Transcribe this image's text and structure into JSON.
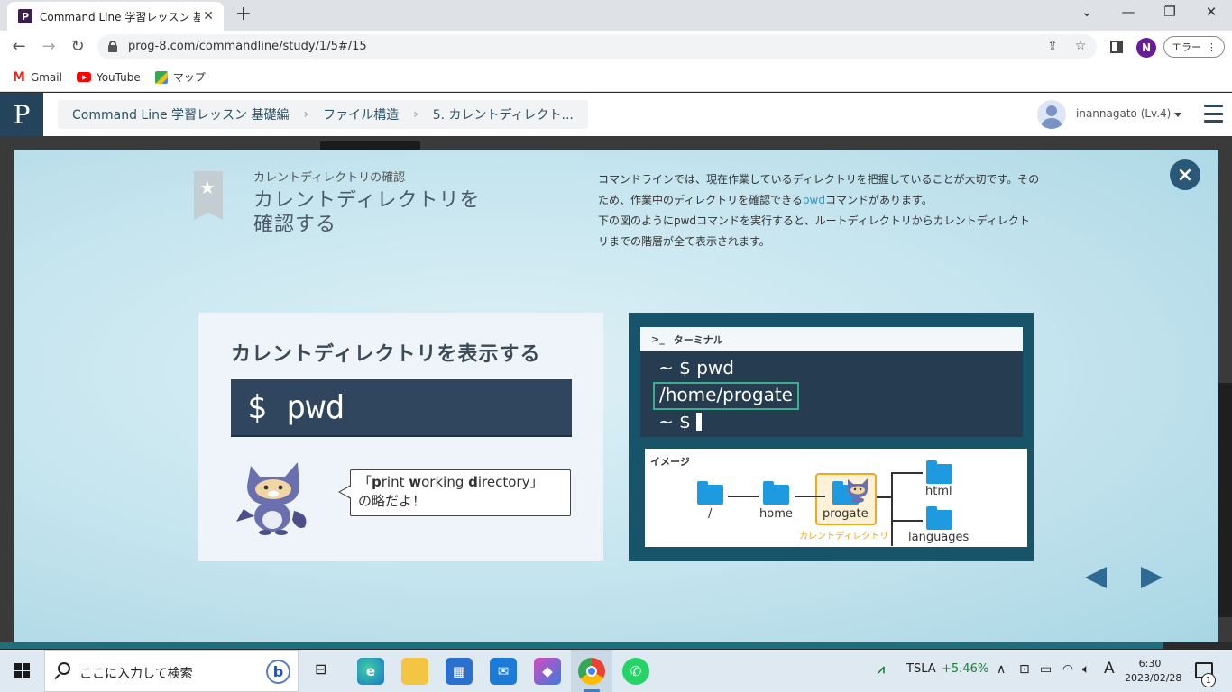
{
  "browser": {
    "tab_title": "Command Line 学習レッスン 基礎編",
    "tab_close": "✕",
    "new_tab": "+",
    "url": "prog-8.com/commandline/study/1/5#/15",
    "profile_initial": "N",
    "error_button": "エラー",
    "error_menu": "⋮",
    "bookmarks": [
      {
        "label": "Gmail",
        "icon": "gmail-icon"
      },
      {
        "label": "YouTube",
        "icon": "youtube-icon"
      },
      {
        "label": "マップ",
        "icon": "maps-icon"
      }
    ]
  },
  "progate": {
    "logo": "P",
    "breadcrumb": [
      "Command Line 学習レッスン 基礎編",
      "ファイル構造",
      "5. カレントディレクト..."
    ],
    "user": "inannagato (Lv.4)"
  },
  "slide": {
    "subtitle": "カレントディレクトリの確認",
    "title_line1": "カレントディレクトリを",
    "title_line2": "確認する",
    "desc_part1": "コマンドラインでは、現在作業しているディレクトリを把握していることが大切です。そのため、作業中のディレクトリを確認できる",
    "desc_highlight": "pwd",
    "desc_part2": "コマンドがあります。",
    "desc_line2": "下の図のようにpwdコマンドを実行すると、ルートディレクトリからカレントディレクトリまでの階層が全て表示されます。",
    "left_card": {
      "heading": "カレントディレクトリを表示する",
      "command": "$ pwd",
      "bubble_open": "「",
      "bubble_p": "p",
      "bubble_rint": "rint ",
      "bubble_w": "w",
      "bubble_orking": "orking ",
      "bubble_d": "d",
      "bubble_irectory": "irectory」",
      "bubble_line2": "の略だよ！"
    },
    "right_card": {
      "terminal_prompt_icon": ">_",
      "terminal_title": "ターミナル",
      "line1": "~ $ pwd",
      "line2": "/home/progate",
      "line3": "~ $",
      "image_label": "イメージ",
      "nodes": [
        "/",
        "home",
        "progate",
        "html",
        "languages"
      ],
      "current_label": "カレントディレクトリ"
    }
  },
  "taskbar": {
    "search_placeholder": "ここに入力して検索",
    "bing": "b",
    "stock_symbol": "TSLA",
    "stock_change": "+5.46%",
    "ime": "A",
    "time": "6:30",
    "date": "2023/02/28",
    "notification_count": "1"
  },
  "colors": {
    "progate_navy": "#24445c",
    "modal_bg": "#c4e4ee",
    "terminal_bg": "#263c50",
    "highlight_blue": "#1a9fd6",
    "current_dir_orange": "#f0a81e",
    "stock_green": "#1a7f37"
  }
}
